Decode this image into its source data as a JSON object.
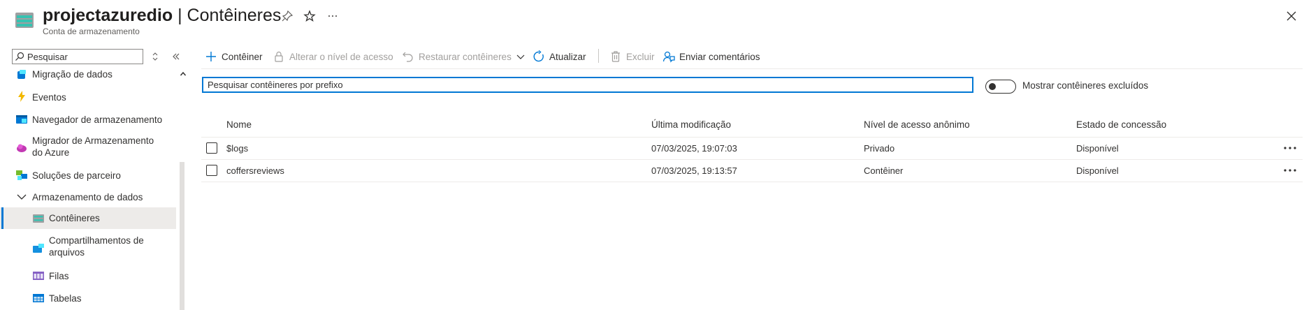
{
  "header": {
    "resource_name": "projectazuredio",
    "separator": " | ",
    "page_name": "Contêineres",
    "subtitle": "Conta de armazenamento",
    "pin_icon": "pin-icon",
    "favorite_icon": "star-icon",
    "more_icon": "ellipsis-icon",
    "close_icon": "close-icon"
  },
  "sidebar": {
    "search_placeholder": "Pesquisar",
    "items": [
      {
        "label": "Migração de dados",
        "icon": "data-migration-icon"
      },
      {
        "label": "Eventos",
        "icon": "lightning-icon"
      },
      {
        "label": "Navegador de armazenamento",
        "icon": "storage-browser-icon"
      },
      {
        "label": "Migrador de Armazenamento",
        "label2": "do Azure",
        "icon": "storage-mover-icon"
      },
      {
        "label": "Soluções de parceiro",
        "icon": "partner-solutions-icon"
      },
      {
        "label": "Armazenamento de dados",
        "icon": "chevron-down-icon"
      },
      {
        "label": "Contêineres",
        "icon": "containers-icon"
      },
      {
        "label": "Compartilhamentos de",
        "label2": "arquivos",
        "icon": "file-share-icon"
      },
      {
        "label": "Filas",
        "icon": "queues-icon"
      },
      {
        "label": "Tabelas",
        "icon": "tables-icon"
      }
    ]
  },
  "toolbar": {
    "add_container": "Contêiner",
    "change_access": "Alterar o nível de acesso",
    "restore": "Restaurar contêineres",
    "refresh": "Atualizar",
    "delete": "Excluir",
    "feedback": "Enviar comentários"
  },
  "filter": {
    "placeholder": "Pesquisar contêineres por prefixo",
    "toggle_label": "Mostrar contêineres excluídos"
  },
  "table": {
    "columns": [
      "Nome",
      "Última modificação",
      "Nível de acesso anônimo",
      "Estado de concessão"
    ],
    "rows": [
      {
        "name": "$logs",
        "modified": "07/03/2025, 19:07:03",
        "access": "Privado",
        "lease": "Disponível"
      },
      {
        "name": "coffersreviews",
        "modified": "07/03/2025, 19:13:57",
        "access": "Contêiner",
        "lease": "Disponível"
      }
    ]
  },
  "colors": {
    "accent": "#0078d4",
    "text": "#323130",
    "disabled": "#a19f9d"
  }
}
